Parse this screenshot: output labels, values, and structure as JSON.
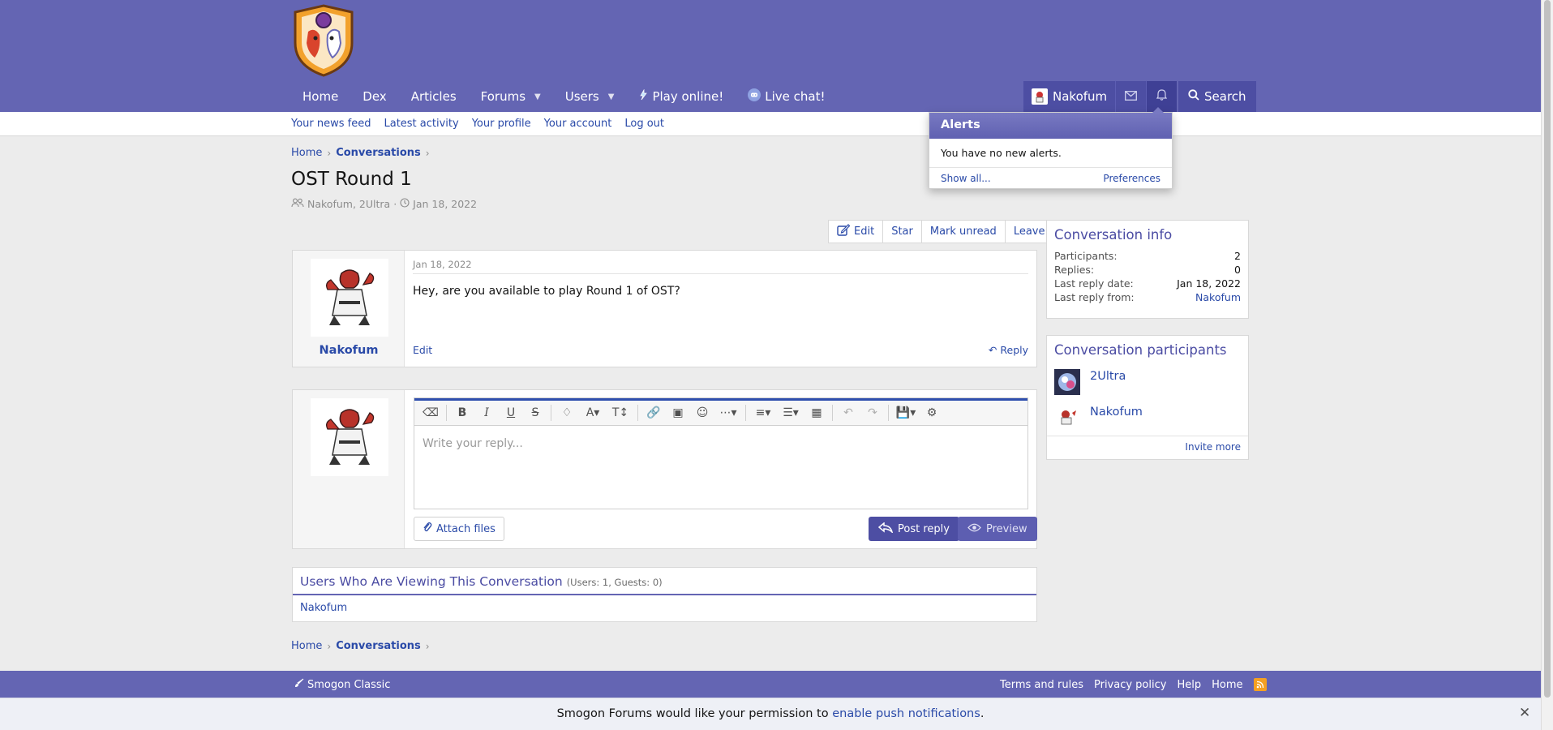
{
  "nav": {
    "items": [
      {
        "label": "Home"
      },
      {
        "label": "Dex"
      },
      {
        "label": "Articles"
      },
      {
        "label": "Forums"
      },
      {
        "label": "Users"
      },
      {
        "label": "Play online!"
      },
      {
        "label": "Live chat!"
      }
    ],
    "user": "Nakofum",
    "search": "Search"
  },
  "subnav": [
    "Your news feed",
    "Latest activity",
    "Your profile",
    "Your account",
    "Log out"
  ],
  "breadcrumb": {
    "home": "Home",
    "section": "Conversations"
  },
  "conversation": {
    "title": "OST Round 1",
    "participants_meta": "Nakofum, 2Ultra",
    "date_meta": "Jan 18, 2022"
  },
  "actions": {
    "edit": "Edit",
    "star": "Star",
    "mark_unread": "Mark unread",
    "leave": "Leave"
  },
  "message": {
    "date": "Jan 18, 2022",
    "body": "Hey, are you available to play Round 1 of OST?",
    "user": "Nakofum",
    "edit": "Edit",
    "reply": "Reply"
  },
  "editor": {
    "placeholder": "Write your reply...",
    "attach": "Attach files",
    "post": "Post reply",
    "preview": "Preview"
  },
  "info": {
    "title": "Conversation info",
    "rows": [
      {
        "label": "Participants:",
        "value": "2"
      },
      {
        "label": "Replies:",
        "value": "0"
      },
      {
        "label": "Last reply date:",
        "value": "Jan 18, 2022"
      },
      {
        "label": "Last reply from:",
        "value": "Nakofum"
      }
    ]
  },
  "participants": {
    "title": "Conversation participants",
    "list": [
      "2Ultra",
      "Nakofum"
    ],
    "invite": "Invite more"
  },
  "viewing": {
    "title": "Users Who Are Viewing This Conversation",
    "counts": "(Users: 1, Guests: 0)",
    "user": "Nakofum"
  },
  "alerts": {
    "title": "Alerts",
    "message": "You have no new alerts.",
    "show_all": "Show all...",
    "preferences": "Preferences"
  },
  "footer": {
    "style": "Smogon Classic",
    "links": [
      "Terms and rules",
      "Privacy policy",
      "Help",
      "Home"
    ]
  },
  "push": {
    "text_before": "Smogon Forums would like your permission to ",
    "link": "enable push notifications",
    "text_after": "."
  },
  "colors": {
    "brand": "#6465b3",
    "accent": "#2a4aa8",
    "button": "#4d4ea3"
  }
}
